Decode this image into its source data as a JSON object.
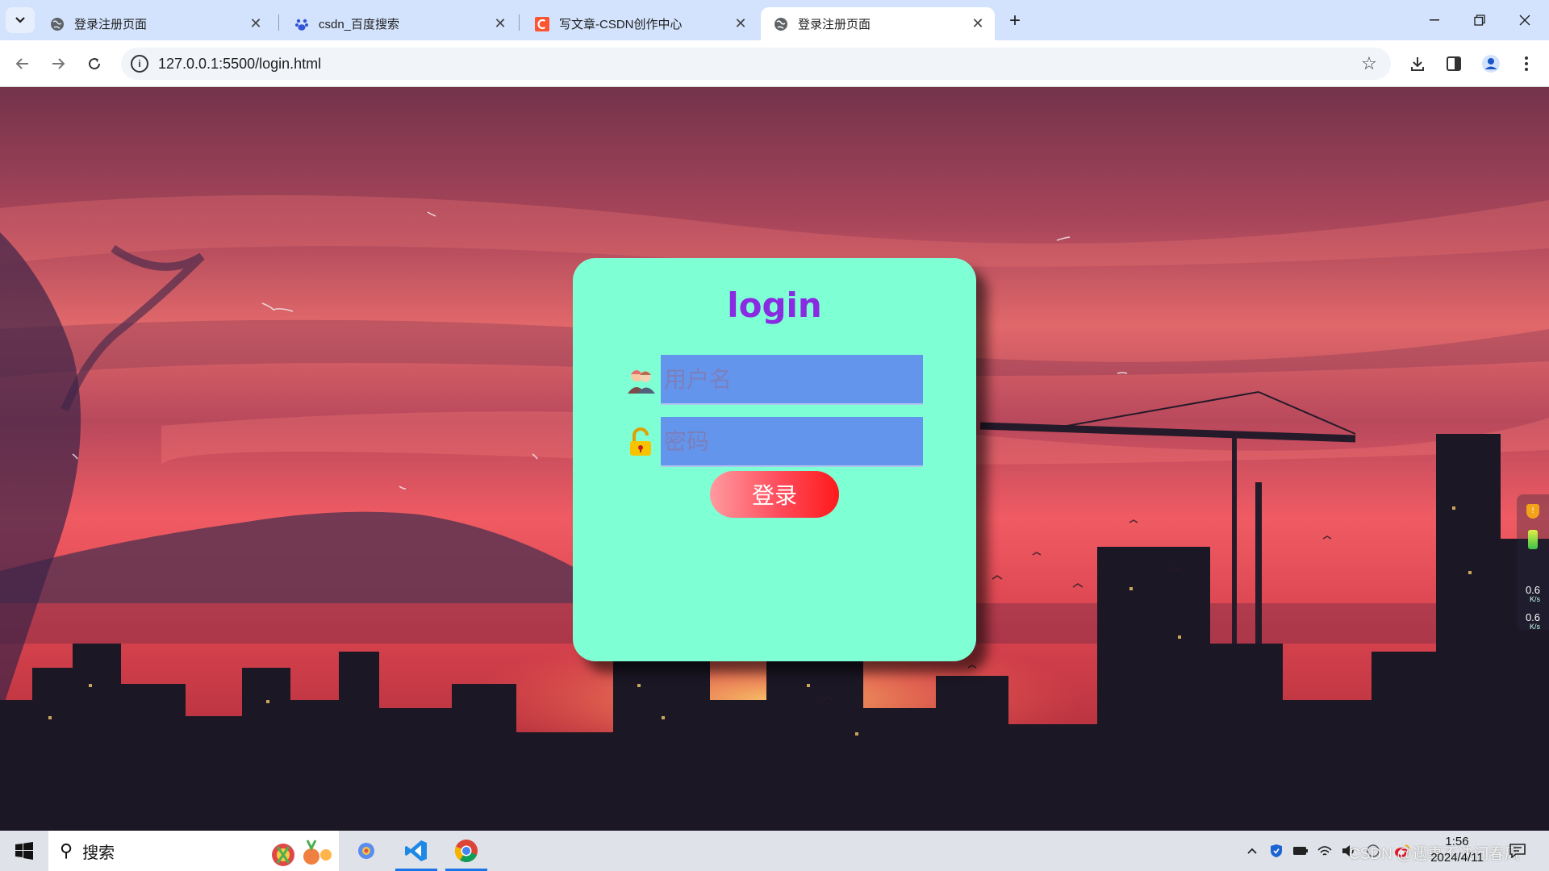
{
  "browser": {
    "tabs": [
      {
        "title": "登录注册页面",
        "icon": "globe-icon",
        "active": false
      },
      {
        "title": "csdn_百度搜索",
        "icon": "baidu-paw-icon",
        "active": false
      },
      {
        "title": "写文章-CSDN创作中心",
        "icon": "csdn-c-icon",
        "active": false
      },
      {
        "title": "登录注册页面",
        "icon": "globe-icon",
        "active": true
      }
    ],
    "address": "127.0.0.1:5500/login.html",
    "colors": {
      "tabstrip": "#d3e3fd",
      "omnibox": "#f1f4f9"
    }
  },
  "login": {
    "title": "login",
    "username_placeholder": "用户名",
    "password_placeholder": "密码",
    "button_label": "登录",
    "colors": {
      "card": "#7fffd4",
      "title": "#8a2be2",
      "input": "#6495ed",
      "button": "#ff1a1a"
    }
  },
  "net_widget": {
    "upload": "0.6",
    "upload_unit": "K/s",
    "download": "0.6",
    "download_unit": "K/s"
  },
  "taskbar": {
    "search_label": "搜索",
    "time": "1:56",
    "date": "2024/4/11",
    "watermark": "CSDN @遇事不决问春风"
  }
}
